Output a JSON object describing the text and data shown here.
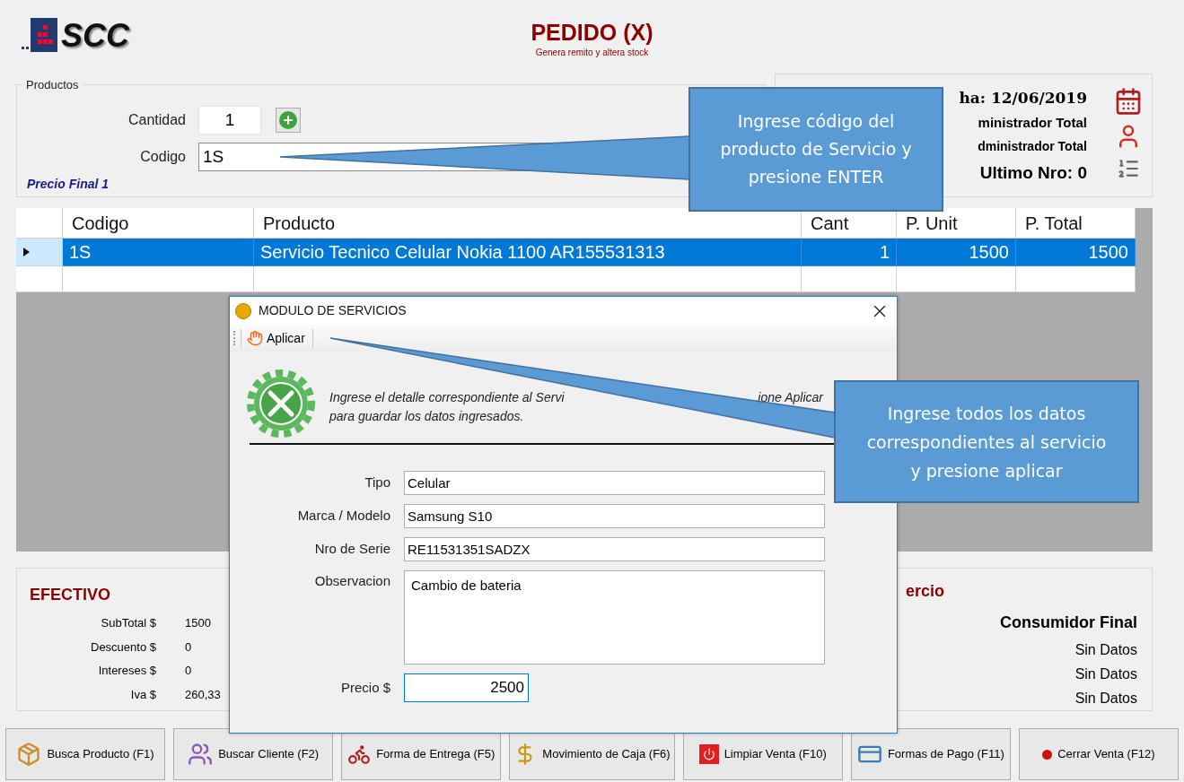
{
  "header": {
    "logo": "SCC",
    "title": "PEDIDO (X)",
    "subtitle": "Genera remito y altera stock"
  },
  "productos": {
    "legend": "Productos",
    "cantidad_label": "Cantidad",
    "cantidad": "1",
    "codigo_label": "Codigo",
    "codigo": "1S",
    "price_list": "Precio Final 1"
  },
  "info": {
    "fecha": "ha: 12/06/2019",
    "line_2": "ministrador Total",
    "line_3": "dministrador Total",
    "ultimo_nro": "Ultimo Nro: 0"
  },
  "table": {
    "columns": [
      "Codigo",
      "Producto",
      "Cant",
      "P. Unit",
      "P. Total"
    ],
    "rows": [
      {
        "selected": true,
        "cells": [
          "1S",
          "Servicio Tecnico Celular Nokia 1100 AR155531313",
          "1",
          "1500",
          "1500"
        ]
      }
    ]
  },
  "totals": {
    "title": "EFECTIVO",
    "rows": [
      {
        "label": "SubTotal $",
        "value": "1500"
      },
      {
        "label": "Descuento $",
        "value": "0"
      },
      {
        "label": "Intereses $",
        "value": "0"
      },
      {
        "label": "Iva $",
        "value": "260,33"
      }
    ]
  },
  "cliente": {
    "title": "ercio",
    "name": "Consumidor Final",
    "lines": [
      "Sin Datos",
      "Sin Datos",
      "Sin Datos"
    ]
  },
  "buttons": [
    {
      "label": "Busca Producto (F1)",
      "kind": "box"
    },
    {
      "label": "Buscar Cliente (F2)",
      "kind": "people"
    },
    {
      "label": "Forma de Entrega (F5)",
      "kind": "delivery"
    },
    {
      "label": "Movimiento de Caja (F6)",
      "kind": "money"
    },
    {
      "label": "Limpiar Venta (F10)",
      "kind": "power"
    },
    {
      "label": "Formas de Pago (F11)",
      "kind": "card"
    },
    {
      "label": "Cerrar Venta (F12)",
      "kind": "dot"
    }
  ],
  "dialog": {
    "title": "MODULO DE SERVICIOS",
    "toolbar_button": "Aplicar",
    "description_1": "Ingrese el detalle correspondiente al Servi",
    "description_1_end": "ione Aplicar",
    "description_2": "para guardar los datos ingresados.",
    "fields": [
      {
        "label": "Tipo",
        "value": "Celular",
        "kind": "text",
        "focused": false
      },
      {
        "label": "Marca / Modelo",
        "value": "Samsung S10",
        "kind": "text",
        "focused": false
      },
      {
        "label": "Nro de Serie",
        "value": "RE11531351SADZX",
        "kind": "text",
        "focused": false
      },
      {
        "label": "Observacion",
        "value": "Cambio de bateria",
        "kind": "multiline",
        "focused": false
      },
      {
        "label": "Precio $",
        "value": "2500",
        "kind": "price",
        "focused": true
      }
    ]
  },
  "callouts": [
    {
      "text": "Ingrese código del producto de Servicio y presione ENTER"
    },
    {
      "text": "Ingrese todos los datos correspondientes al servicio y presione aplicar"
    }
  ]
}
